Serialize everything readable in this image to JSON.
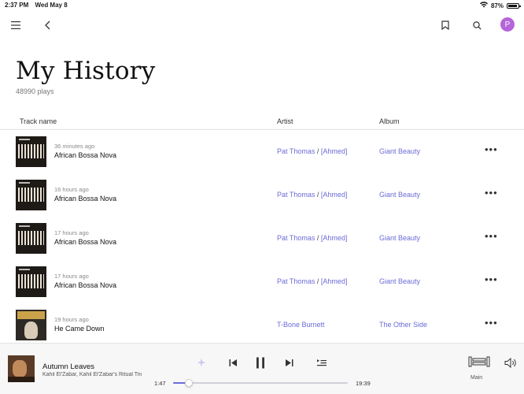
{
  "status": {
    "time": "2:37 PM",
    "date": "Wed May 8",
    "battery": "87%"
  },
  "nav": {
    "menu_icon": "hamburger-menu-icon",
    "back_icon": "chevron-left-icon",
    "bookmark_icon": "bookmark-icon",
    "search_icon": "search-icon",
    "avatar_letter": "P"
  },
  "page": {
    "title": "My History",
    "plays": "48990 plays"
  },
  "columns": {
    "track": "Track name",
    "artist": "Artist",
    "album": "Album"
  },
  "history": [
    {
      "time": "36 minutes ago",
      "track": "African Bossa Nova",
      "artist1": "Pat Thomas",
      "sep": "/",
      "artist2": "[Ahmed]",
      "album": "Giant Beauty",
      "art": "giant"
    },
    {
      "time": "16 hours ago",
      "track": "African Bossa Nova",
      "artist1": "Pat Thomas",
      "sep": "/",
      "artist2": "[Ahmed]",
      "album": "Giant Beauty",
      "art": "giant"
    },
    {
      "time": "17 hours ago",
      "track": "African Bossa Nova",
      "artist1": "Pat Thomas",
      "sep": "/",
      "artist2": "[Ahmed]",
      "album": "Giant Beauty",
      "art": "giant"
    },
    {
      "time": "17 hours ago",
      "track": "African Bossa Nova",
      "artist1": "Pat Thomas",
      "sep": "/",
      "artist2": "[Ahmed]",
      "album": "Giant Beauty",
      "art": "giant"
    },
    {
      "time": "19 hours ago",
      "track": "He Came Down",
      "artist1": "T-Bone Burnett",
      "sep": "",
      "artist2": "",
      "album": "The Other Side",
      "art": "tbone"
    }
  ],
  "more_glyph": "•••",
  "player": {
    "title": "Autumn Leaves",
    "artist": "Kahil El'Zabar, Kahil El'Zabar's Ritual Tric...",
    "elapsed": "1:47",
    "total": "19:39",
    "progress": 0.09,
    "zone": "Main",
    "accent": "#6b6bd8"
  }
}
